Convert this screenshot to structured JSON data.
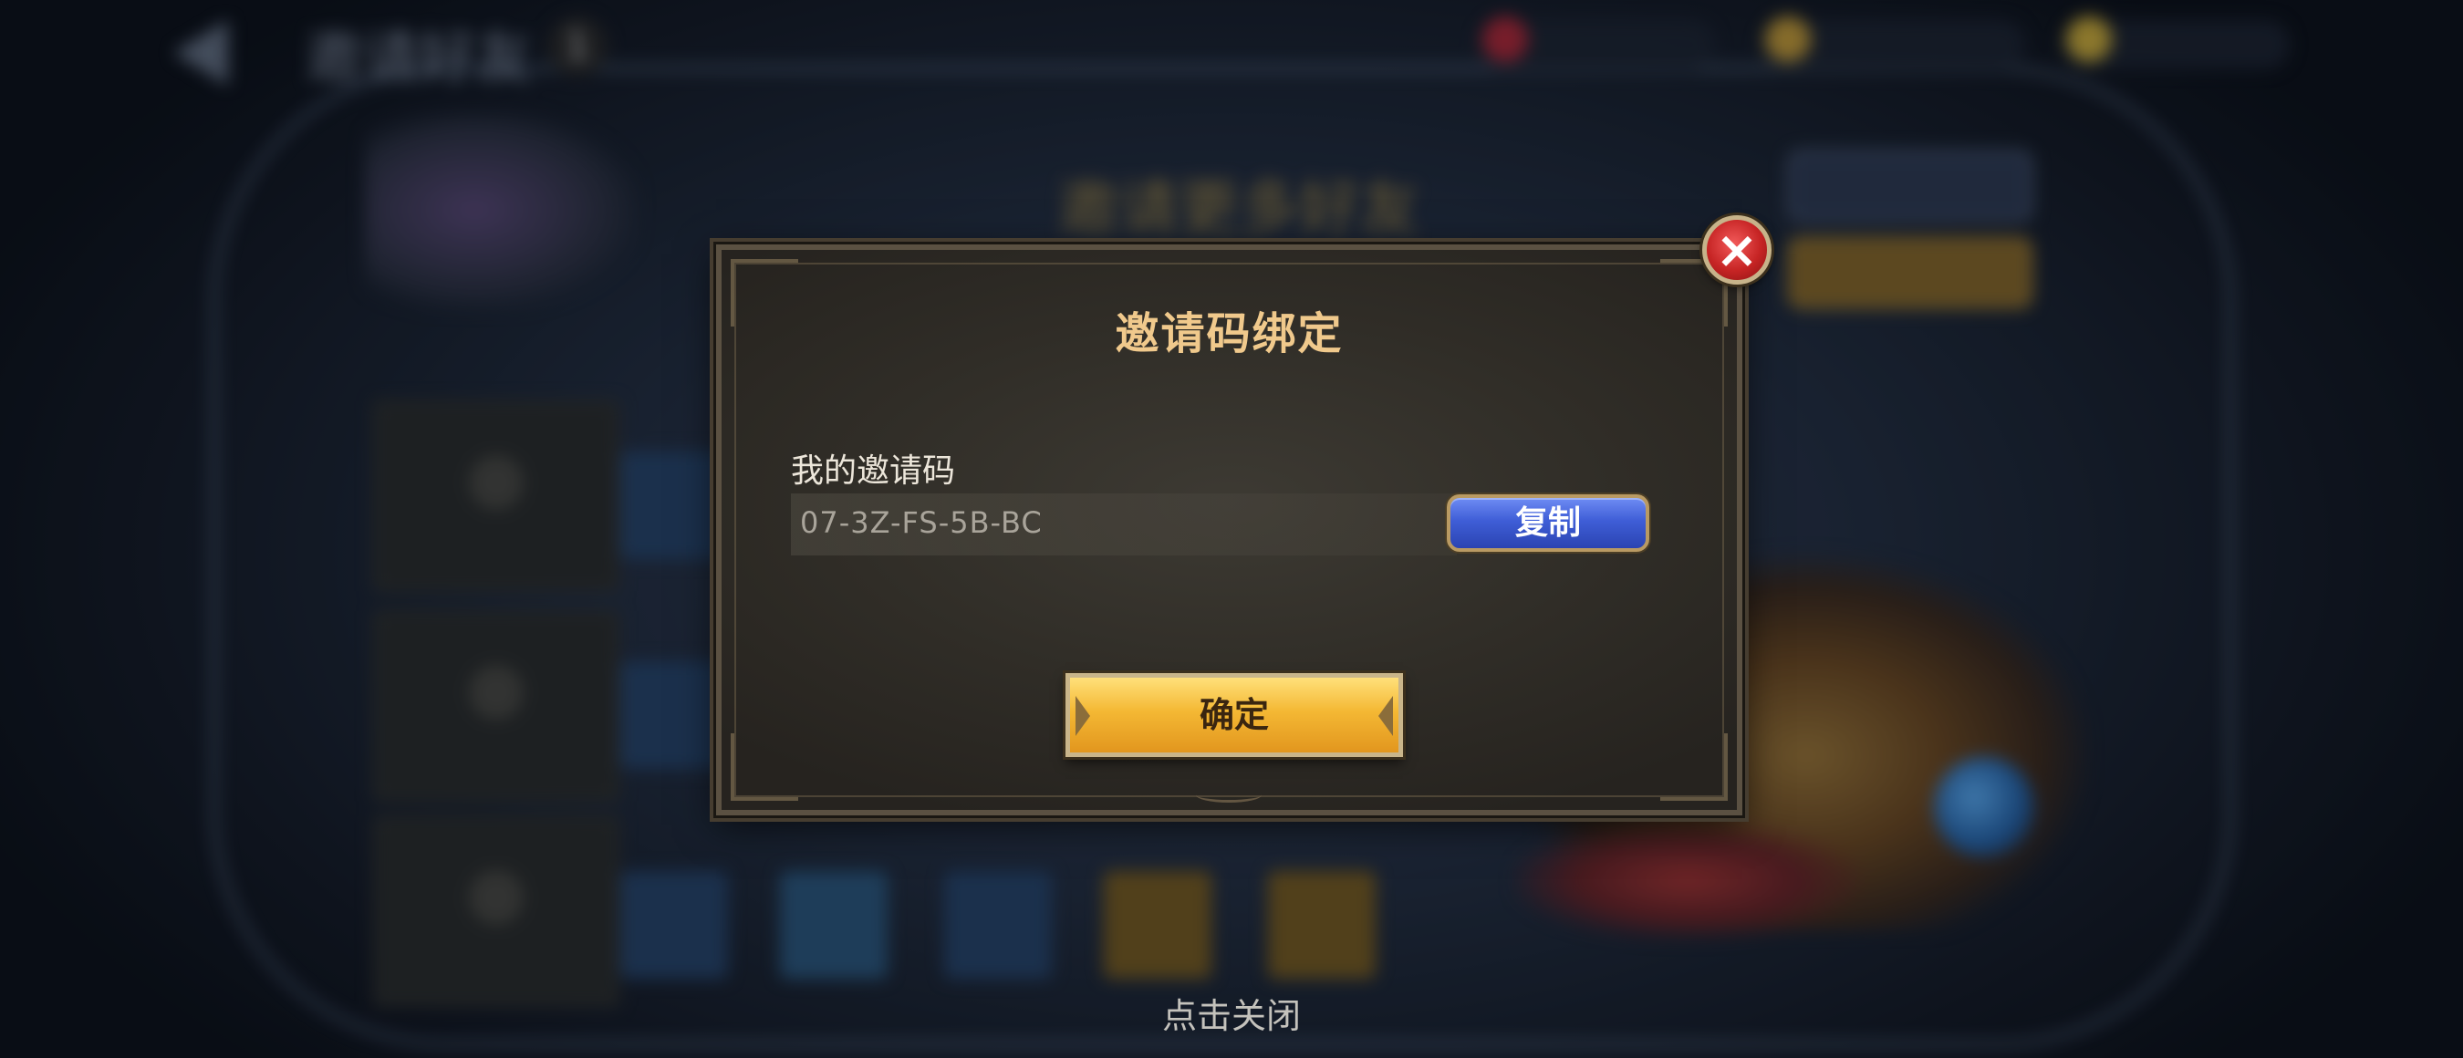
{
  "background": {
    "screen_title": "邀请好友",
    "badge_count": "1",
    "banner_title": "邀请更多好友"
  },
  "dialog": {
    "title": "邀请码绑定",
    "my_code_label": "我的邀请码",
    "invite_code": "07-3Z-FS-5B-BC",
    "copy_label": "复制",
    "confirm_label": "确定",
    "close_icon": "close-icon"
  },
  "footer": {
    "tap_to_close": "点击关闭"
  },
  "colors": {
    "title_gold": "#f0c98c",
    "copy_blue": "#3f5ed7",
    "confirm_gold": "#f4b834",
    "close_red": "#c62424"
  }
}
